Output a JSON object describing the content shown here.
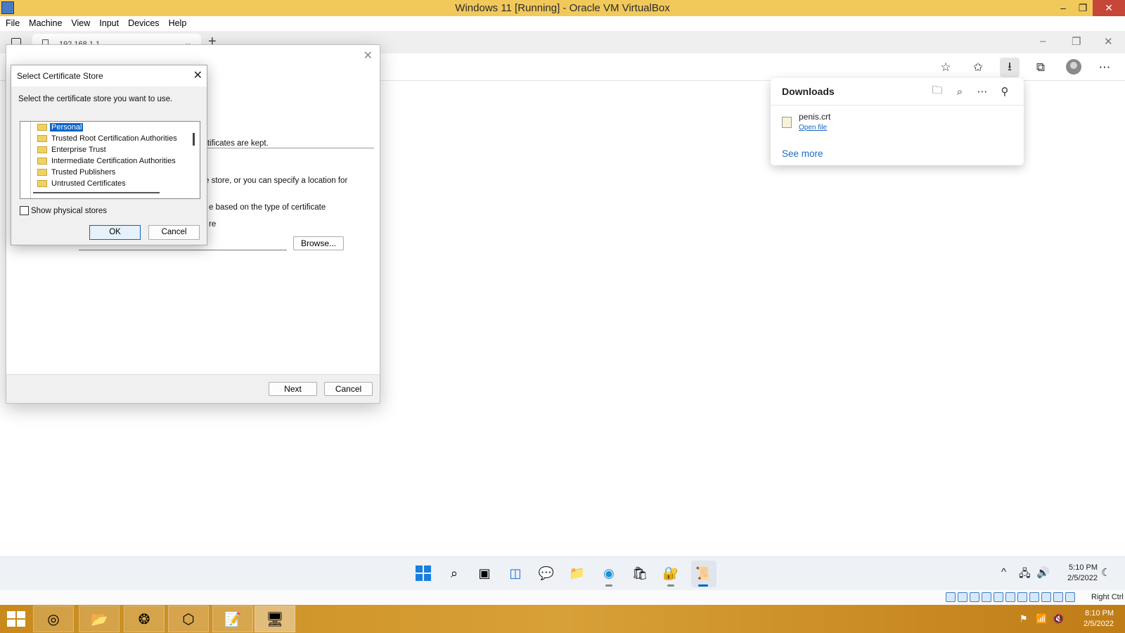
{
  "host_window": {
    "title": "Windows 11 [Running] - Oracle VM VirtualBox",
    "minimize": "–",
    "restore": "❐",
    "close": "✕"
  },
  "host_menu": [
    "File",
    "Machine",
    "View",
    "Input",
    "Devices",
    "Help"
  ],
  "browser": {
    "tab_title": "192.168.1.1",
    "tab_chevron": "⌄",
    "new_tab": "+",
    "guest_min": "–",
    "guest_max": "❐",
    "guest_close": "✕",
    "toolbar_icons": {
      "add_favorite": "☆",
      "favorites": "✩",
      "downloads": "⭳",
      "collections": "⧉",
      "more": "⋯"
    }
  },
  "downloads_panel": {
    "title": "Downloads",
    "open_folder_icon": "🗀",
    "search_icon": "⌕",
    "more_icon": "⋯",
    "pin_icon": "⚲",
    "file_name": "penis.crt",
    "open_file": "Open file",
    "see_more": "See more"
  },
  "wizard": {
    "close": "✕",
    "text_kept": "rtificates are kept.",
    "text_store": "e store, or you can specify a location for",
    "text_auto": "e based on the type of certificate",
    "text_re": "re",
    "browse_label": "Browse...",
    "next_label": "Next",
    "cancel_label": "Cancel"
  },
  "store_dialog": {
    "title": "Select Certificate Store",
    "close": "✕",
    "prompt": "Select the certificate store you want to use.",
    "items": [
      "Personal",
      "Trusted Root Certification Authorities",
      "Enterprise Trust",
      "Intermediate Certification Authorities",
      "Trusted Publishers",
      "Untrusted Certificates"
    ],
    "selected_item": "Personal",
    "show_physical_label": "Show physical stores",
    "show_physical_checked": false,
    "ok_label": "OK",
    "cancel_label": "Cancel"
  },
  "guest_taskbar": {
    "icons": {
      "search": "⌕",
      "task_view": "▣",
      "widgets": "◫",
      "chat": "💬",
      "explorer": "📁",
      "edge": "◉",
      "store": "🛍",
      "cert_manager": "🔐",
      "cert_wizard": "📜"
    },
    "tray": {
      "chevron": "^",
      "network": "🖧",
      "volume": "🔊",
      "notifications": "☾"
    },
    "time": "5:10 PM",
    "date": "2/5/2022"
  },
  "vb_status": {
    "host_key": "Right Ctrl"
  },
  "host_taskbar": {
    "apps": {
      "chrome": "◎",
      "explorer": "📂",
      "app3": "❂",
      "virtualbox": "⬡",
      "notepad": "📝",
      "vm": "🖥"
    },
    "tray": {
      "flag": "⚑",
      "network": "📶",
      "volume": "🔇"
    },
    "time": "8:10 PM",
    "date": "2/5/2022"
  }
}
